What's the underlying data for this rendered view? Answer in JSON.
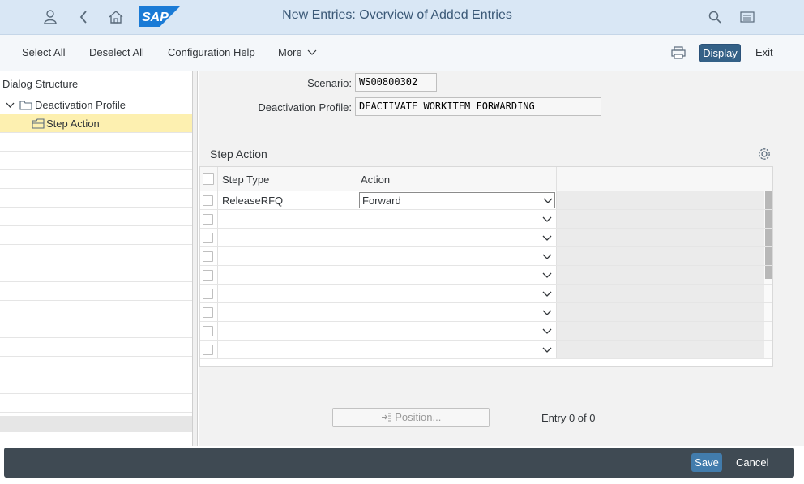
{
  "shell": {
    "title": "New Entries: Overview of Added Entries",
    "logo_text": "SAP",
    "icons": [
      "user-icon",
      "back-icon",
      "home-icon",
      "search-icon",
      "menu-icon"
    ],
    "brand_color": "#1a7bd6"
  },
  "toolbar": {
    "select_all": "Select All",
    "deselect_all": "Deselect All",
    "config_help": "Configuration Help",
    "more": "More",
    "display": "Display",
    "exit": "Exit"
  },
  "dialog_structure": {
    "title": "Dialog Structure",
    "items": [
      {
        "label": "Deactivation Profile",
        "expanded": true,
        "selected": false
      },
      {
        "label": "Step Action",
        "selected": true
      }
    ]
  },
  "fields": {
    "scenario_label": "Scenario:",
    "scenario_value": "WS00800302",
    "profile_label": "Deactivation Profile:",
    "profile_value": "DEACTIVATE WORKITEM FORWARDING"
  },
  "table": {
    "title": "Step Action",
    "columns": [
      "Step Type",
      "Action"
    ],
    "rows": [
      {
        "step_type": "ReleaseRFQ",
        "action": "Forward"
      },
      {
        "step_type": "",
        "action": ""
      },
      {
        "step_type": "",
        "action": ""
      },
      {
        "step_type": "",
        "action": ""
      },
      {
        "step_type": "",
        "action": ""
      },
      {
        "step_type": "",
        "action": ""
      },
      {
        "step_type": "",
        "action": ""
      },
      {
        "step_type": "",
        "action": ""
      },
      {
        "step_type": "",
        "action": ""
      }
    ]
  },
  "position_button": "Position...",
  "entry_info": "Entry 0 of 0",
  "footer": {
    "save": "Save",
    "cancel": "Cancel"
  },
  "colors": {
    "selection": "#fdf0b0",
    "primary_button": "#427cac",
    "footer_bar": "#3f4a53"
  }
}
